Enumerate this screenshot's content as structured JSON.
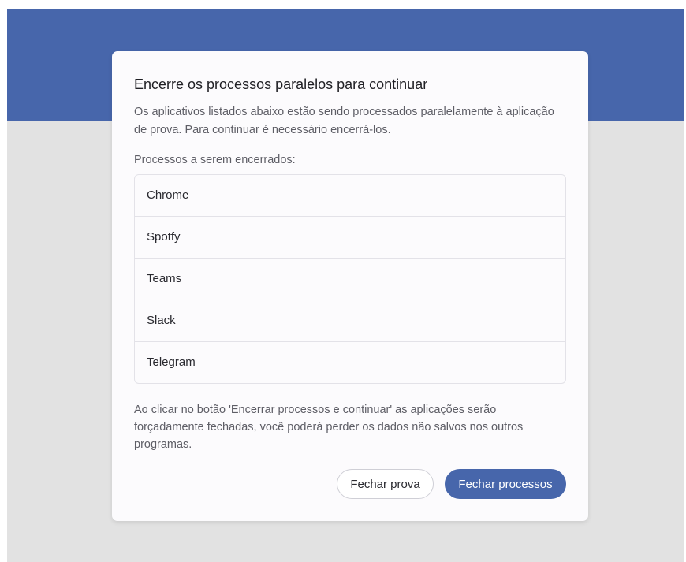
{
  "colors": {
    "banner": "#4766ab",
    "page_background": "#e2e2e2",
    "dialog_background": "#fcfbfd",
    "primary_button": "#4766ab"
  },
  "dialog": {
    "title": "Encerre os processos paralelos para continuar",
    "description": "Os aplicativos listados abaixo estão sendo processados paralelamente à aplicação de prova. Para continuar é necessário encerrá-los.",
    "list_label": "Processos a serem encerrados:",
    "processes": [
      "Chrome",
      "Spotfy",
      "Teams",
      "Slack",
      "Telegram"
    ],
    "warning": "Ao clicar no botão 'Encerrar processos e continuar' as aplicações serão forçadamente fechadas, você poderá perder os dados não salvos nos outros programas.",
    "buttons": {
      "secondary_label": "Fechar prova",
      "primary_label": "Fechar processos"
    }
  }
}
